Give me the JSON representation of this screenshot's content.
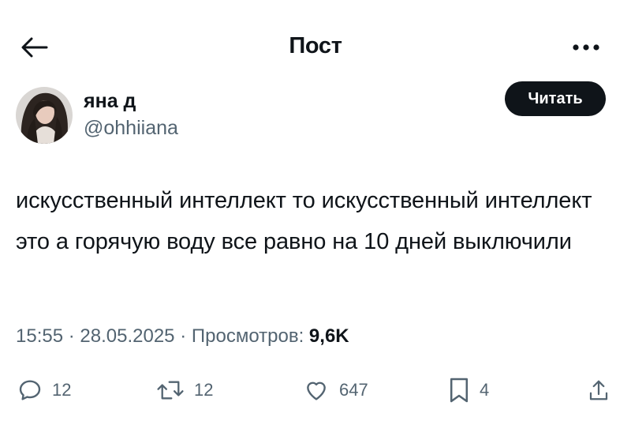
{
  "header": {
    "title": "Пост",
    "back_icon": "arrow-left-icon",
    "more_icon": "more-horizontal-icon"
  },
  "author": {
    "name": "яна д",
    "handle": "@ohhiiana",
    "follow_label": "Читать"
  },
  "post": {
    "text": "искусственный интеллект то искусственный интеллект это а горячую воду все равно на 10 дней выключили",
    "time": "15:55",
    "separator": "·",
    "date": "28.05.2025",
    "views_label": "Просмотров:",
    "views": "9,6K"
  },
  "actions": {
    "reply_count": "12",
    "retweet_count": "12",
    "like_count": "647",
    "bookmark_count": "4"
  },
  "colors": {
    "text": "#0f1419",
    "secondary": "#536471",
    "button_bg": "#0f1419"
  }
}
